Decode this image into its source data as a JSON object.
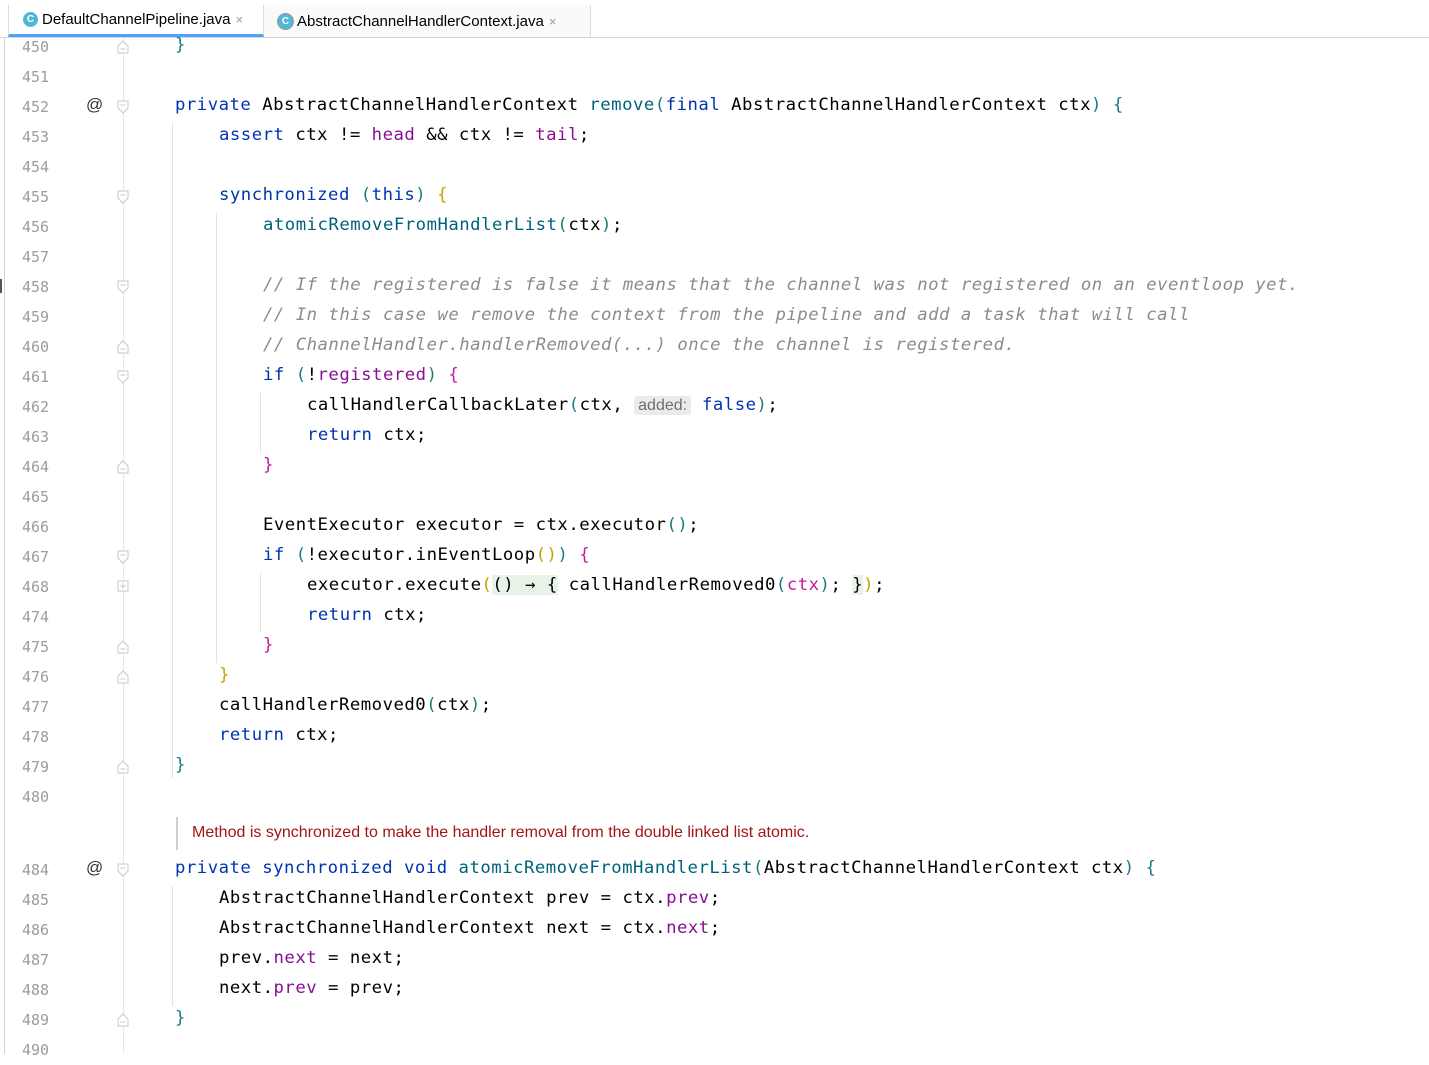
{
  "tabs": [
    {
      "icon_letter": "C",
      "label": "DefaultChannelPipeline.java",
      "close": "×"
    },
    {
      "icon_letter": "C",
      "label": "AbstractChannelHandlerContext.java",
      "close": "×"
    }
  ],
  "icons": {
    "override": "@",
    "fold": "fold-marker-icon",
    "file": "java-class-file-icon"
  },
  "doc_comment": "Method is synchronized to make the handler removal from the double linked list atomic.",
  "lines": [
    {
      "n": "450",
      "text": "}"
    },
    {
      "n": "451",
      "text": ""
    },
    {
      "n": "452",
      "text": "private AbstractChannelHandlerContext remove(final AbstractChannelHandlerContext ctx) {",
      "annotation": "@"
    },
    {
      "n": "453",
      "text": "assert ctx != head && ctx != tail;"
    },
    {
      "n": "454",
      "text": ""
    },
    {
      "n": "455",
      "text": "synchronized (this) {"
    },
    {
      "n": "456",
      "text": "atomicRemoveFromHandlerList(ctx);"
    },
    {
      "n": "457",
      "text": ""
    },
    {
      "n": "458",
      "text": "// If the registered is false it means that the channel was not registered on an eventloop yet."
    },
    {
      "n": "459",
      "text": "// In this case we remove the context from the pipeline and add a task that will call"
    },
    {
      "n": "460",
      "text": "// ChannelHandler.handlerRemoved(...) once the channel is registered."
    },
    {
      "n": "461",
      "text": "if (!registered) {"
    },
    {
      "n": "462",
      "text": "callHandlerCallbackLater(ctx, added: false);",
      "hint": "added:"
    },
    {
      "n": "463",
      "text": "return ctx;"
    },
    {
      "n": "464",
      "text": "}"
    },
    {
      "n": "465",
      "text": ""
    },
    {
      "n": "466",
      "text": "EventExecutor executor = ctx.executor();"
    },
    {
      "n": "467",
      "text": "if (!executor.inEventLoop()) {"
    },
    {
      "n": "468",
      "text": "executor.execute(() → { callHandlerRemoved0(ctx); });"
    },
    {
      "n": "474",
      "text": "return ctx;"
    },
    {
      "n": "475",
      "text": "}"
    },
    {
      "n": "476",
      "text": "}"
    },
    {
      "n": "477",
      "text": "callHandlerRemoved0(ctx);"
    },
    {
      "n": "478",
      "text": "return ctx;"
    },
    {
      "n": "479",
      "text": "}"
    },
    {
      "n": "480",
      "text": ""
    },
    {
      "n": "484",
      "text": "private synchronized void atomicRemoveFromHandlerList(AbstractChannelHandlerContext ctx) {",
      "annotation": "@"
    },
    {
      "n": "485",
      "text": "AbstractChannelHandlerContext prev = ctx.prev;"
    },
    {
      "n": "486",
      "text": "AbstractChannelHandlerContext next = ctx.next;"
    },
    {
      "n": "487",
      "text": "prev.next = next;"
    },
    {
      "n": "488",
      "text": "next.prev = prev;"
    },
    {
      "n": "489",
      "text": "}"
    },
    {
      "n": "490",
      "text": ""
    }
  ]
}
